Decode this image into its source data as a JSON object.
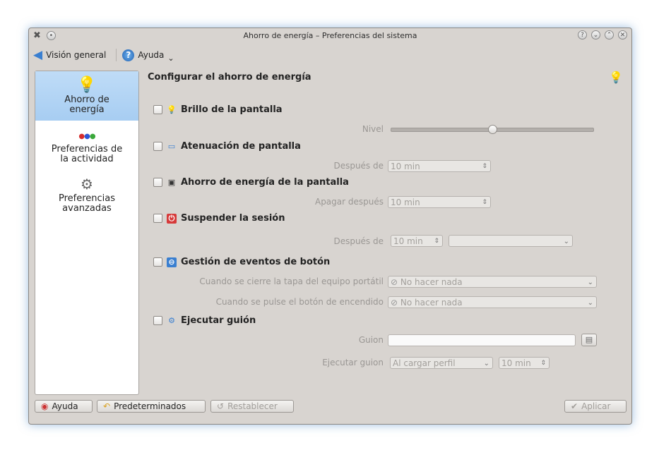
{
  "window": {
    "title": "Ahorro de energía – Preferencias del sistema"
  },
  "toolbar": {
    "overview_label": "Visión general",
    "help_label": "Ayuda"
  },
  "sidebar": {
    "items": [
      {
        "label_1": "Ahorro de",
        "label_2": "energía",
        "icon": "lightbulb-icon"
      },
      {
        "label_1": "Preferencias de",
        "label_2": "la actividad",
        "icon": "activity-dots-icon"
      },
      {
        "label_1": "Preferencias",
        "label_2": "avanzadas",
        "icon": "tools-icon"
      }
    ]
  },
  "content": {
    "heading": "Configurar el ahorro de energía",
    "brightness": {
      "label": "Brillo de la pantalla",
      "level_label": "Nivel",
      "level": 0.5
    },
    "dim": {
      "label": "Atenuación de pantalla",
      "after_label": "Después de",
      "after_value": "10 min"
    },
    "screen_saving": {
      "label": "Ahorro de energía de la pantalla",
      "off_after_label": "Apagar después",
      "off_after_value": "10 min"
    },
    "suspend": {
      "label": "Suspender la sesión",
      "after_label": "Después de",
      "after_value": "10 min",
      "action_value": ""
    },
    "buttons": {
      "label": "Gestión de eventos de botón",
      "lid_label": "Cuando se cierre la tapa del equipo portátil",
      "lid_value": "No hacer nada",
      "power_label": "Cuando se pulse el botón de encendido",
      "power_value": "No hacer nada"
    },
    "script": {
      "label": "Ejecutar guión",
      "script_label": "Guion",
      "script_value": "",
      "run_label": "Ejecutar guion",
      "run_value": "Al cargar perfil",
      "run_time": "10 min"
    }
  },
  "footer": {
    "help": "Ayuda",
    "defaults": "Predeterminados",
    "reset": "Restablecer",
    "apply": "Aplicar"
  }
}
